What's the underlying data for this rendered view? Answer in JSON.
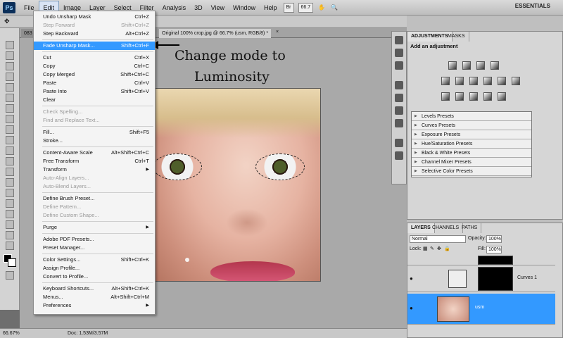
{
  "menubar": {
    "logo": "Ps",
    "menus": [
      "File",
      "Edit",
      "Image",
      "Layer",
      "Select",
      "Filter",
      "Analysis",
      "3D",
      "View",
      "Window",
      "Help"
    ],
    "br_label": "Br",
    "zoom_value": "66.7",
    "workspace": "ESSENTIALS"
  },
  "doc_tabs": {
    "tab1": "083",
    "tab2": "Original 100% crop.jpg @ 66.7% (usm, RGB/8) *"
  },
  "edit_menu": {
    "items": [
      {
        "label": "Undo Unsharp Mask",
        "shortcut": "Ctrl+Z",
        "disabled": false
      },
      {
        "label": "Step Forward",
        "shortcut": "Shift+Ctrl+Z",
        "disabled": true
      },
      {
        "label": "Step Backward",
        "shortcut": "Alt+Ctrl+Z",
        "disabled": false
      },
      {
        "sep": true
      },
      {
        "label": "Fade Unsharp Mask...",
        "shortcut": "Shift+Ctrl+F",
        "highlight": true
      },
      {
        "sep": true
      },
      {
        "label": "Cut",
        "shortcut": "Ctrl+X"
      },
      {
        "label": "Copy",
        "shortcut": "Ctrl+C"
      },
      {
        "label": "Copy Merged",
        "shortcut": "Shift+Ctrl+C"
      },
      {
        "label": "Paste",
        "shortcut": "Ctrl+V"
      },
      {
        "label": "Paste Into",
        "shortcut": "Shift+Ctrl+V"
      },
      {
        "label": "Clear",
        "shortcut": ""
      },
      {
        "sep": true
      },
      {
        "label": "Check Spelling...",
        "shortcut": "",
        "disabled": true
      },
      {
        "label": "Find and Replace Text...",
        "shortcut": "",
        "disabled": true
      },
      {
        "sep": true
      },
      {
        "label": "Fill...",
        "shortcut": "Shift+F5"
      },
      {
        "label": "Stroke...",
        "shortcut": ""
      },
      {
        "sep": true
      },
      {
        "label": "Content-Aware Scale",
        "shortcut": "Alt+Shift+Ctrl+C"
      },
      {
        "label": "Free Transform",
        "shortcut": "Ctrl+T"
      },
      {
        "label": "Transform",
        "shortcut": "",
        "submenu": true
      },
      {
        "label": "Auto-Align Layers...",
        "shortcut": "",
        "disabled": true
      },
      {
        "label": "Auto-Blend Layers...",
        "shortcut": "",
        "disabled": true
      },
      {
        "sep": true
      },
      {
        "label": "Define Brush Preset...",
        "shortcut": ""
      },
      {
        "label": "Define Pattern...",
        "shortcut": "",
        "disabled": true
      },
      {
        "label": "Define Custom Shape...",
        "shortcut": "",
        "disabled": true
      },
      {
        "sep": true
      },
      {
        "label": "Purge",
        "shortcut": "",
        "submenu": true
      },
      {
        "sep": true
      },
      {
        "label": "Adobe PDF Presets...",
        "shortcut": ""
      },
      {
        "label": "Preset Manager...",
        "shortcut": ""
      },
      {
        "sep": true
      },
      {
        "label": "Color Settings...",
        "shortcut": "Shift+Ctrl+K"
      },
      {
        "label": "Assign Profile...",
        "shortcut": ""
      },
      {
        "label": "Convert to Profile...",
        "shortcut": ""
      },
      {
        "sep": true
      },
      {
        "label": "Keyboard Shortcuts...",
        "shortcut": "Alt+Shift+Ctrl+K"
      },
      {
        "label": "Menus...",
        "shortcut": "Alt+Shift+Ctrl+M"
      },
      {
        "label": "Preferences",
        "shortcut": "",
        "submenu": true
      }
    ]
  },
  "annotation": {
    "line1": "Change mode to",
    "line2": "Luminosity"
  },
  "adjustments": {
    "tab_adjustments": "ADJUSTMENTS",
    "tab_masks": "MASKS",
    "title": "Add an adjustment",
    "presets": [
      "Levels Presets",
      "Curves Presets",
      "Exposure Presets",
      "Hue/Saturation Presets",
      "Black & White Presets",
      "Channel Mixer Presets",
      "Selective Color Presets"
    ]
  },
  "layers": {
    "tab_layers": "LAYERS",
    "tab_channels": "CHANNELS",
    "tab_paths": "PATHS",
    "blend_mode": "Normal",
    "opacity_label": "Opacity:",
    "opacity_value": "100%",
    "lock_label": "Lock:",
    "fill_label": "Fill:",
    "fill_value": "100%",
    "layer1_name": "Curves 1",
    "layer2_name": "usm"
  },
  "status": {
    "zoom": "66.67%",
    "doc": "Doc: 1.53M/3.57M"
  }
}
